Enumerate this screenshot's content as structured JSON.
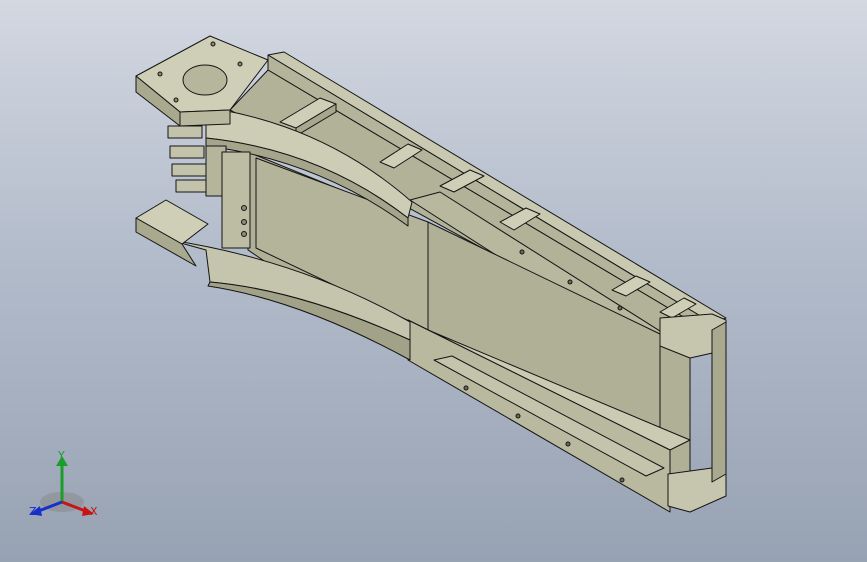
{
  "viewport": {
    "background_top": "#d3d8e1",
    "background_bottom": "#97a2b3"
  },
  "model": {
    "part_color": "#c8c8b0",
    "part_shade": "#aeae94",
    "part_dark": "#8c8c74",
    "edge_color": "#141414"
  },
  "triad": {
    "x_label": "X",
    "y_label": "Y",
    "z_label": "Z",
    "x_color": "#c81414",
    "y_color": "#1a9e2a",
    "z_color": "#1830c8"
  }
}
